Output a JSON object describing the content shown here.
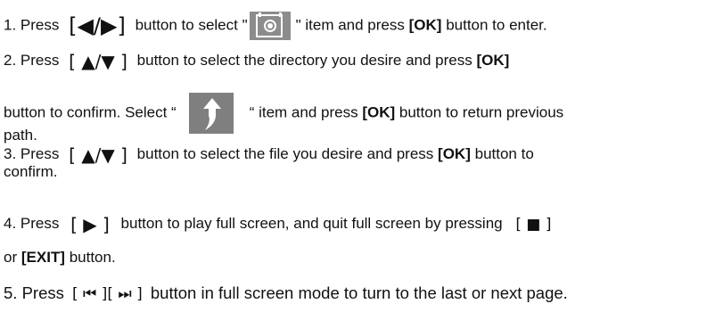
{
  "step1": {
    "prefix": "1. Press",
    "key": "[◀/▶]",
    "mid": "button to select \"",
    "icon": "photo-folder-icon",
    "after_icon": "\" item and press",
    "ok": "[OK]",
    "suffix": "button to enter."
  },
  "step2": {
    "prefix": "2. Press",
    "key": "[ ▲/▼ ]",
    "mid": "button to select the directory you desire and press",
    "ok": "[OK]",
    "cont_prefix": "button to confirm. Select “",
    "icon": "up-arrow-icon",
    "after_icon": "“ item and press",
    "ok2": "[OK]",
    "cont_suffix": "button to return previous",
    "tail": "path."
  },
  "step3": {
    "prefix": "3. Press",
    "key": "[ ▲/▼ ]",
    "mid": "button to select the file you desire and press",
    "ok": "[OK]",
    "suffix": "button to",
    "tail": "confirm."
  },
  "step4": {
    "prefix": "4. Press",
    "key": "[ ▶ ]",
    "mid": "button to play full screen, and quit full screen by pressing",
    "key2": "[ ■ ]",
    "tail_prefix": "or",
    "exit": "[EXIT]",
    "tail_suffix": "button."
  },
  "step5": {
    "prefix": "5. Press",
    "key": "[ ⏮ ][ ⏭ ]",
    "suffix": "button in full screen mode to turn to the last or next page."
  }
}
